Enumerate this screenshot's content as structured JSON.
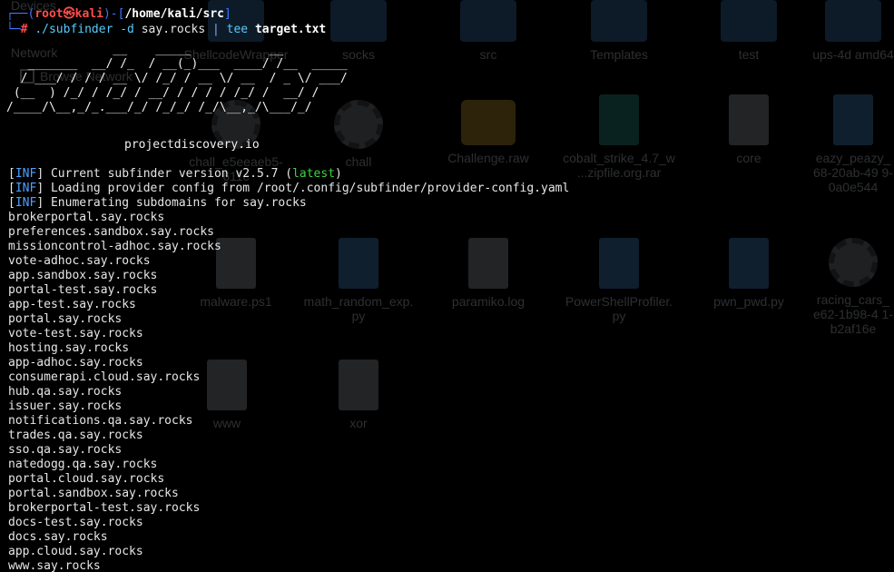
{
  "background": {
    "sidebar": {
      "devices": "Devices",
      "network": "Network",
      "item": "Browse Network"
    },
    "files": [
      {
        "name": "ShellcodeWrapper",
        "icon": "folder-icon"
      },
      {
        "name": "socks",
        "icon": "folder-icon"
      },
      {
        "name": "src",
        "icon": "folder-icon"
      },
      {
        "name": "Templates",
        "icon": "folder-icon"
      },
      {
        "name": "test",
        "icon": "folder-icon"
      },
      {
        "name": "ups-4d amd64",
        "icon": "folder-icon"
      },
      {
        "name": "chall_e5eeaeb5-611c",
        "icon": "gear-icon"
      },
      {
        "name": "chall",
        "icon": "gear-icon"
      },
      {
        "name": "Challenge.raw",
        "icon": "media-icon"
      },
      {
        "name": "cobalt_strike_4.7_w ...zipfile.org.rar",
        "icon": "archive-icon"
      },
      {
        "name": "core",
        "icon": "document-icon"
      },
      {
        "name": "eazy_peazy_ 68-20ab-49 9-0a0e544",
        "icon": "python-icon"
      },
      {
        "name": "malware.ps1",
        "icon": "document-icon"
      },
      {
        "name": "math_random_exp. py",
        "icon": "python-icon"
      },
      {
        "name": "paramiko.log",
        "icon": "document-icon"
      },
      {
        "name": "PowerShellProfiler. py",
        "icon": "python-icon"
      },
      {
        "name": "pwn_pwd.py",
        "icon": "python-icon"
      },
      {
        "name": "racing_cars_ e62-1b98-4 1-b2af16e",
        "icon": "gear-icon"
      },
      {
        "name": "www",
        "icon": "document-icon"
      },
      {
        "name": "xor",
        "icon": "document-icon"
      }
    ]
  },
  "terminal": {
    "prompt": {
      "user": "root",
      "at": "㉿",
      "host": "kali",
      "cwd": "/home/kali/src",
      "symbol": "#",
      "cmd_bin": "./subfinder",
      "cmd_flag": "-d",
      "cmd_arg": "say.rocks",
      "pipe": "|",
      "tee": "tee",
      "outfile": "target.txt"
    },
    "banner": "               __    _____           __         \n   _______  __/ /_  / __(_)___  ____/ /__  _____\n  / ___/ / / / __ \\/ /_/ / __ \\/ __  / _ \\/ ___/\n (__  ) /_/ / /_/ / __/ / / / / /_/ /  __/ /    \n/____/\\__,_/_.___/_/ /_/_/ /_/\\__,_/\\___/_/     ",
    "byline": "projectdiscovery.io",
    "info_lines": [
      {
        "tag": "INF",
        "text": " Current subfinder version v2.5.7 (",
        "extra": "latest",
        "end": ")"
      },
      {
        "tag": "INF",
        "text": " Loading provider config from /root/.config/subfinder/provider-config.yaml",
        "extra": "",
        "end": ""
      },
      {
        "tag": "INF",
        "text": " Enumerating subdomains for say.rocks",
        "extra": "",
        "end": ""
      }
    ],
    "subdomains": [
      "brokerportal.say.rocks",
      "preferences.sandbox.say.rocks",
      "missioncontrol-adhoc.say.rocks",
      "vote-adhoc.say.rocks",
      "app.sandbox.say.rocks",
      "portal-test.say.rocks",
      "app-test.say.rocks",
      "portal.say.rocks",
      "vote-test.say.rocks",
      "hosting.say.rocks",
      "app-adhoc.say.rocks",
      "consumerapi.cloud.say.rocks",
      "hub.qa.say.rocks",
      "issuer.say.rocks",
      "notifications.qa.say.rocks",
      "trades.qa.say.rocks",
      "sso.qa.say.rocks",
      "natedogg.qa.say.rocks",
      "portal.cloud.say.rocks",
      "portal.sandbox.say.rocks",
      "brokerportal-test.say.rocks",
      "docs-test.say.rocks",
      "docs.say.rocks",
      "app.cloud.say.rocks",
      "www.say.rocks"
    ]
  }
}
